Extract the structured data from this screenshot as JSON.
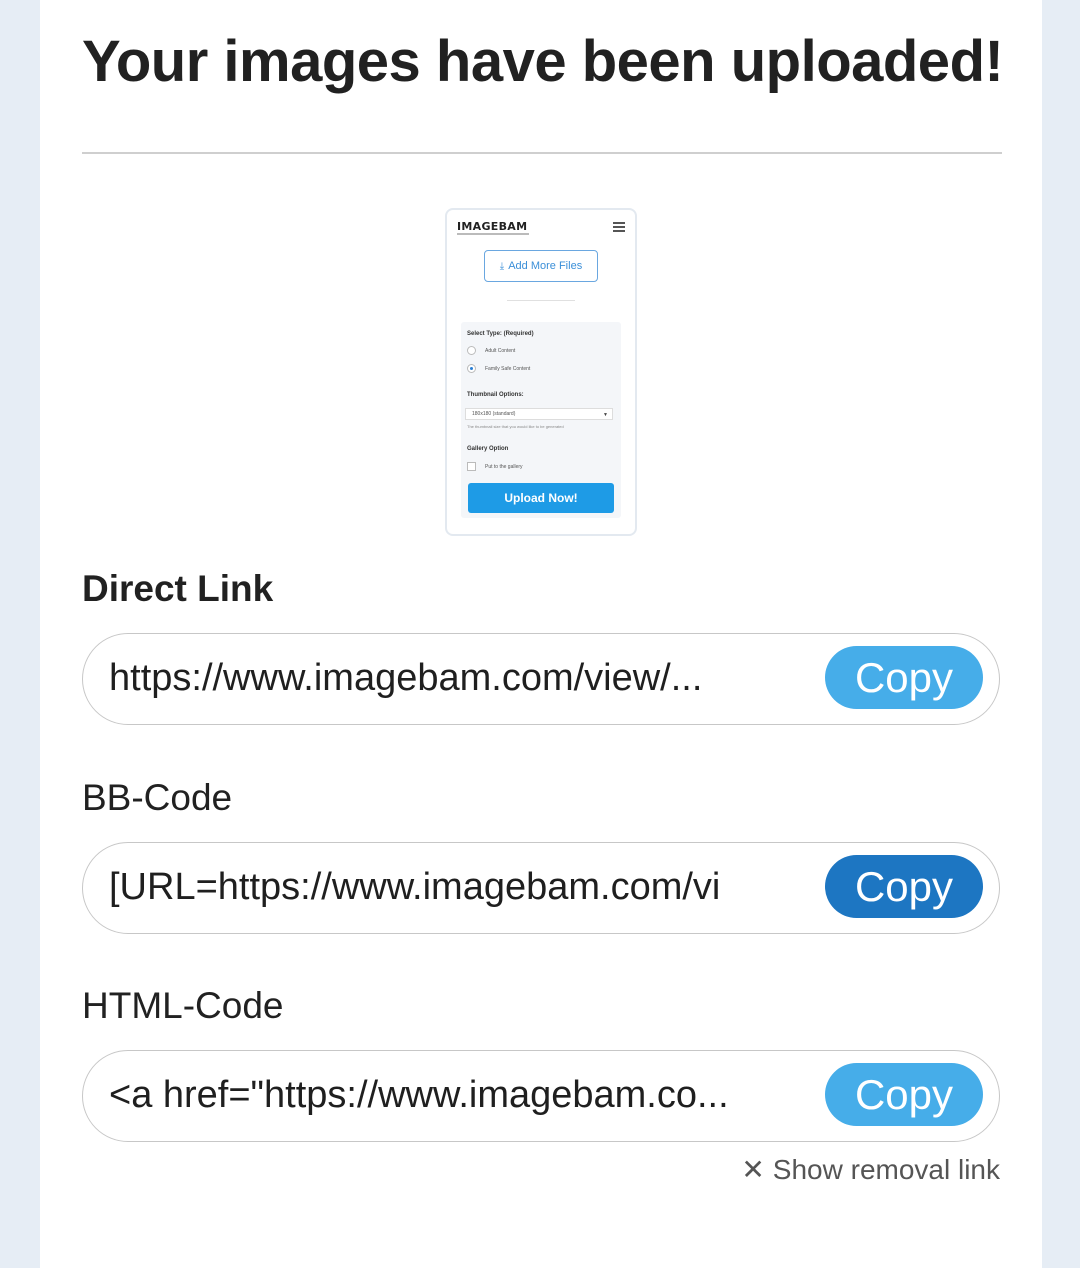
{
  "page": {
    "title": "Your images have been uploaded!"
  },
  "thumbnail": {
    "logo": "IMAGEBAM",
    "add_more_files": "Add More Files",
    "select_type_label": "Select Type: (Required)",
    "option_adult": "Adult Content",
    "option_family": "Family Safe Content",
    "thumbnail_options_label": "Thumbnail Options:",
    "thumbnail_select_value": "180x180 (standard)",
    "thumbnail_hint": "The thumbnail size that you would like to be generated",
    "gallery_option_label": "Gallery Option",
    "gallery_checkbox_label": "Put to the gallery",
    "upload_button": "Upload Now!",
    "icons": {
      "upload": "upload-icon",
      "menu": "hamburger-menu-icon"
    }
  },
  "fields": {
    "direct_link": {
      "label": "Direct Link",
      "value": "https://www.imagebam.com/view/...",
      "copy_label": "Copy"
    },
    "bb_code": {
      "label": "BB-Code",
      "value": "[URL=https://www.imagebam.com/vi",
      "copy_label": "Copy"
    },
    "html_code": {
      "label": "HTML-Code",
      "value": "<a href=\"https://www.imagebam.co...",
      "copy_label": "Copy"
    }
  },
  "removal": {
    "label": "Show removal link",
    "icon": "close-icon"
  },
  "colors": {
    "copy_button": "#46ade9",
    "copy_button_active": "#1d76c2",
    "page_background": "#e6edf5",
    "upload_button": "#1e9be6"
  }
}
